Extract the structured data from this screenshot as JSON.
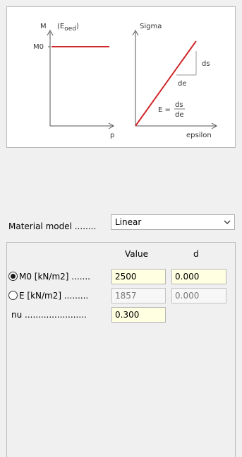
{
  "diagram": {
    "left": {
      "y_axis_label_main": "M",
      "y_axis_label_paren_open": "(E",
      "y_axis_label_sub": "oed",
      "y_axis_label_paren_close": ")",
      "level_label": "M0",
      "x_axis_label": "p"
    },
    "right": {
      "y_axis_label": "Sigma",
      "ds_label": "ds",
      "de_label": "de",
      "formula_lhs": "E =",
      "formula_num": "ds",
      "formula_den": "de",
      "x_axis_label": "epsilon"
    },
    "line_color": "#d1282b"
  },
  "material": {
    "label": "Material model ........",
    "selected": "Linear"
  },
  "params": {
    "headers": {
      "value": "Value",
      "d": "d"
    },
    "rows": [
      {
        "label": "M0 [kN/m2] .......",
        "selected": true,
        "value": "2500",
        "d": "0.000",
        "enabled": true
      },
      {
        "label": "E [kN/m2] .........",
        "selected": false,
        "value": "1857",
        "d": "0.000",
        "enabled": false
      },
      {
        "label": "nu .......................",
        "value": "0.300",
        "enabled": true
      }
    ]
  }
}
